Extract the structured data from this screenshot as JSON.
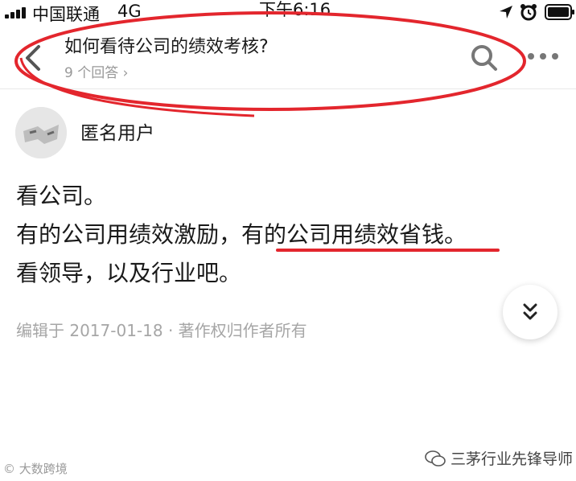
{
  "status_bar": {
    "carrier": "中国联通",
    "network": "4G",
    "time": "下午6:16"
  },
  "header": {
    "title": "如何看待公司的绩效考核?",
    "answer_count": "9 个回答 ›"
  },
  "author": {
    "name": "匿名用户"
  },
  "answer": {
    "lines": [
      "看公司。",
      "有的公司用绩效激励，有的公司用绩效省钱。",
      "看领导，以及行业吧。"
    ]
  },
  "meta": "编辑于 2017-01-18 · 著作权归作者所有",
  "watermarks": {
    "left": "© 大数跨境",
    "right": "三茅行业先锋导师"
  },
  "colors": {
    "annotation_red": "#e3262d",
    "muted_text": "#999999"
  }
}
